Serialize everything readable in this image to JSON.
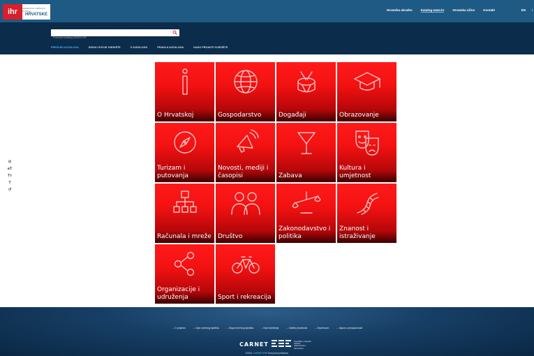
{
  "header": {
    "logo_mark": "ihr",
    "logo_small": "SREDIŠNJI DRŽAVNI PORTAL",
    "logo_big": "HRVATSKE",
    "links": [
      "Hrvatska ukratko",
      "Katalog www.hr",
      "Hrvatska uživo",
      "Kontakt"
    ],
    "active_link": "Katalog www.hr",
    "lang": "EN",
    "lang_extra": "I"
  },
  "search": {
    "placeholder": "Pretraži Katalog WWW.HR"
  },
  "nav": {
    "items": [
      "PREGLED KATALOGA",
      "DODAJ SVOJE SJEDIŠTE",
      "O KATALOGU",
      "PRAVILA KATALOGA",
      "KAKO PRIJAVITI SJEDIŠTE"
    ],
    "active": "PREGLED KATALOGA"
  },
  "accessibility_tools": [
    "⊙",
    "aT",
    "Tт",
    "T",
    "↺"
  ],
  "categories": [
    {
      "label": "O Hrvatskoj",
      "icon": "info-icon"
    },
    {
      "label": "Gospodarstvo",
      "icon": "globe-icon"
    },
    {
      "label": "Događaji",
      "icon": "drum-icon"
    },
    {
      "label": "Obrazovanje",
      "icon": "graduation-cap-icon"
    },
    {
      "label": "Turizam i\nputovanja",
      "icon": "compass-icon"
    },
    {
      "label": "Novosti, mediji i\nčasopisi",
      "icon": "megaphone-icon"
    },
    {
      "label": "Zabava",
      "icon": "cocktail-icon"
    },
    {
      "label": "Kultura i umjetnost",
      "icon": "theater-masks-icon"
    },
    {
      "label": "Računala i mreže",
      "icon": "network-icon"
    },
    {
      "label": "Društvo",
      "icon": "people-icon"
    },
    {
      "label": "Zakonodavstvo i\npolitika",
      "icon": "scales-icon"
    },
    {
      "label": "Znanost i\nistraživanje",
      "icon": "dna-icon"
    },
    {
      "label": "Organizacije i\nudruženja",
      "icon": "share-icon"
    },
    {
      "label": "Sport i rekreacija",
      "icon": "bicycle-icon"
    }
  ],
  "footer": {
    "links": [
      "→ O projektu",
      "→ Opis mrežnog sjedišta",
      "→ Mapa mrežnog sjedišta",
      "→ Impl korištenja",
      "→ Zaštita privatnosti",
      "→ Impressum",
      "→ Izjava o pristupačnosti"
    ],
    "carnet": "CARNET",
    "fer_text": "Sveučilište u Zagrebu\nFakultet\nelektrotehnike i\nračunarstva",
    "copyright_prefix": "©2024.",
    "copyright_link": "CARNET/FER",
    "copyright_suffix": "Sva prava pridržana."
  },
  "colors": {
    "topbar": "#1f5a85",
    "band": "#0b2c4a",
    "tile": "#ff1a1a",
    "active_nav": "#44c2ff"
  }
}
